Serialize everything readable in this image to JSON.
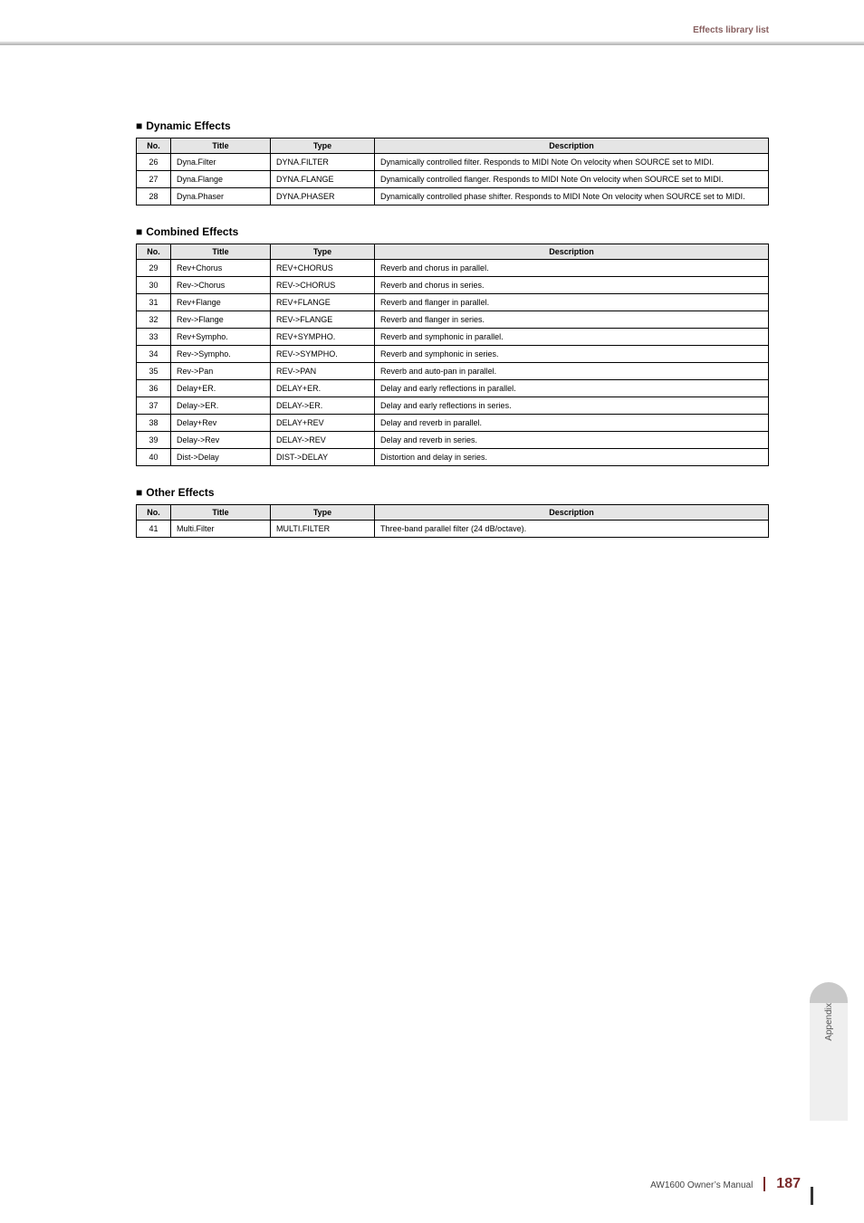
{
  "header": {
    "section": "Effects library list"
  },
  "sections": {
    "dynamic": {
      "heading": "Dynamic Effects",
      "cols": {
        "no": "No.",
        "title": "Title",
        "type": "Type",
        "desc": "Description"
      },
      "rows": [
        {
          "no": "26",
          "title": "Dyna.Filter",
          "type": "DYNA.FILTER",
          "desc": "Dynamically controlled filter. Responds to MIDI Note On velocity when SOURCE set to MIDI."
        },
        {
          "no": "27",
          "title": "Dyna.Flange",
          "type": "DYNA.FLANGE",
          "desc": "Dynamically controlled flanger. Responds to MIDI Note On velocity when SOURCE set to MIDI."
        },
        {
          "no": "28",
          "title": "Dyna.Phaser",
          "type": "DYNA.PHASER",
          "desc": "Dynamically controlled phase shifter. Responds to MIDI Note On velocity when SOURCE set to MIDI."
        }
      ]
    },
    "combined": {
      "heading": "Combined Effects",
      "cols": {
        "no": "No.",
        "title": "Title",
        "type": "Type",
        "desc": "Description"
      },
      "rows": [
        {
          "no": "29",
          "title": "Rev+Chorus",
          "type": "REV+CHORUS",
          "desc": "Reverb and chorus in parallel."
        },
        {
          "no": "30",
          "title": "Rev->Chorus",
          "type": "REV->CHORUS",
          "desc": "Reverb and chorus in series."
        },
        {
          "no": "31",
          "title": "Rev+Flange",
          "type": "REV+FLANGE",
          "desc": "Reverb and flanger in parallel."
        },
        {
          "no": "32",
          "title": "Rev->Flange",
          "type": "REV->FLANGE",
          "desc": "Reverb and flanger in series."
        },
        {
          "no": "33",
          "title": "Rev+Sympho.",
          "type": "REV+SYMPHO.",
          "desc": "Reverb and symphonic in parallel."
        },
        {
          "no": "34",
          "title": "Rev->Sympho.",
          "type": "REV->SYMPHO.",
          "desc": "Reverb and symphonic in series."
        },
        {
          "no": "35",
          "title": "Rev->Pan",
          "type": "REV->PAN",
          "desc": "Reverb and auto-pan in parallel."
        },
        {
          "no": "36",
          "title": "Delay+ER.",
          "type": "DELAY+ER.",
          "desc": "Delay and early reflections in parallel."
        },
        {
          "no": "37",
          "title": "Delay->ER.",
          "type": "DELAY->ER.",
          "desc": "Delay and early reflections in series."
        },
        {
          "no": "38",
          "title": "Delay+Rev",
          "type": "DELAY+REV",
          "desc": "Delay and reverb in parallel."
        },
        {
          "no": "39",
          "title": "Delay->Rev",
          "type": "DELAY->REV",
          "desc": "Delay and reverb in series."
        },
        {
          "no": "40",
          "title": "Dist->Delay",
          "type": "DIST->DELAY",
          "desc": "Distortion and delay in series."
        }
      ]
    },
    "other": {
      "heading": "Other Effects",
      "cols": {
        "no": "No.",
        "title": "Title",
        "type": "Type",
        "desc": "Description"
      },
      "rows": [
        {
          "no": "41",
          "title": "Multi.Filter",
          "type": "MULTI.FILTER",
          "desc": "Three-band parallel filter (24 dB/octave)."
        }
      ]
    }
  },
  "sideTab": {
    "label": "Appendix"
  },
  "footer": {
    "manual": "AW1600  Owner’s Manual",
    "page": "187"
  }
}
